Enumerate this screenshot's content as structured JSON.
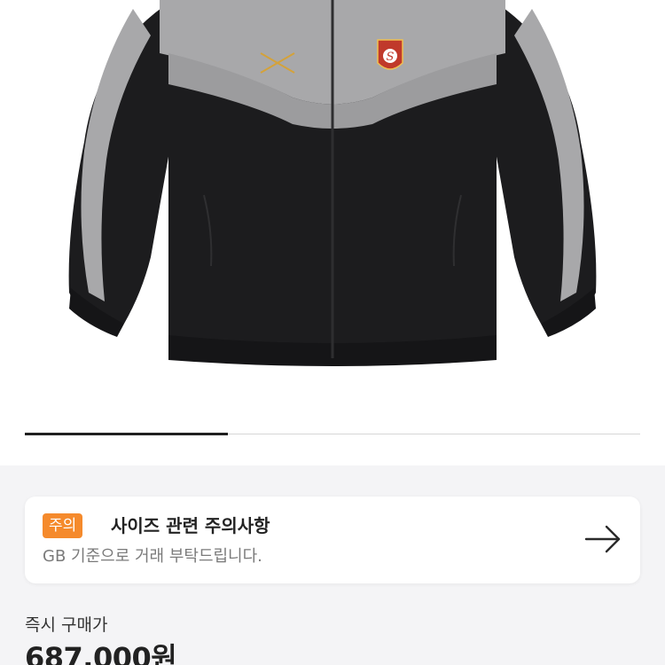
{
  "product": {
    "image_name": "black-grey-track-jacket",
    "logo_text": "UMBRO",
    "crest_letter": "S"
  },
  "carousel": {
    "progress": 0.33
  },
  "notice": {
    "badge": "주의",
    "title": "사이즈 관련 주의사항",
    "subtitle": "GB 기준으로 거래 부탁드립니다.",
    "arrow_icon": "arrow-right-icon"
  },
  "pricing": {
    "label": "즉시 구매가",
    "value": "687,000원"
  },
  "colors": {
    "badge": "#f58a2c",
    "jacket_black": "#1c1c1e",
    "jacket_grey": "#a8a8aa",
    "section_bg": "#f4f4f6"
  }
}
